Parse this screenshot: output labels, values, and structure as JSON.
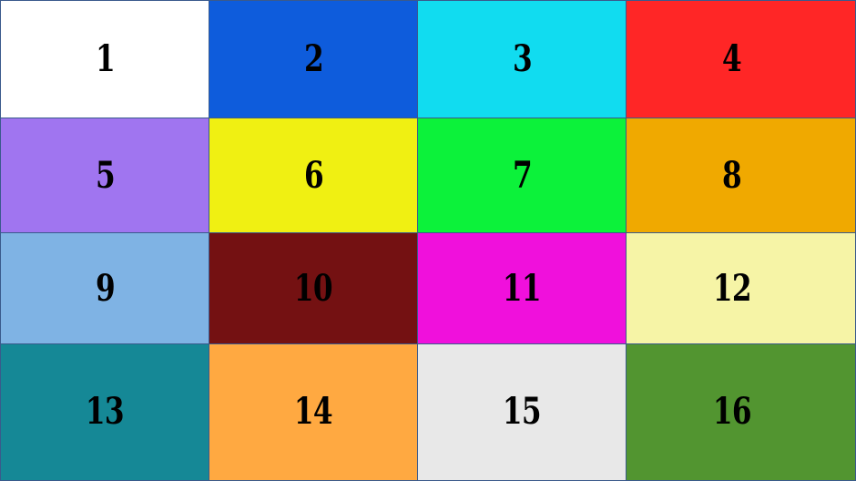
{
  "tiles": [
    {
      "label": "1",
      "color": "#ffffff"
    },
    {
      "label": "2",
      "color": "#0e5cdc"
    },
    {
      "label": "3",
      "color": "#11dcf0"
    },
    {
      "label": "4",
      "color": "#ff2626"
    },
    {
      "label": "5",
      "color": "#a075f0"
    },
    {
      "label": "6",
      "color": "#f0f012"
    },
    {
      "label": "7",
      "color": "#0cf23a"
    },
    {
      "label": "8",
      "color": "#f0a900"
    },
    {
      "label": "9",
      "color": "#7fb3e4"
    },
    {
      "label": "10",
      "color": "#741112"
    },
    {
      "label": "11",
      "color": "#f010dc"
    },
    {
      "label": "12",
      "color": "#f6f4a6"
    },
    {
      "label": "13",
      "color": "#158896"
    },
    {
      "label": "14",
      "color": "#ffa941"
    },
    {
      "label": "15",
      "color": "#e8e8e8"
    },
    {
      "label": "16",
      "color": "#529530"
    }
  ]
}
